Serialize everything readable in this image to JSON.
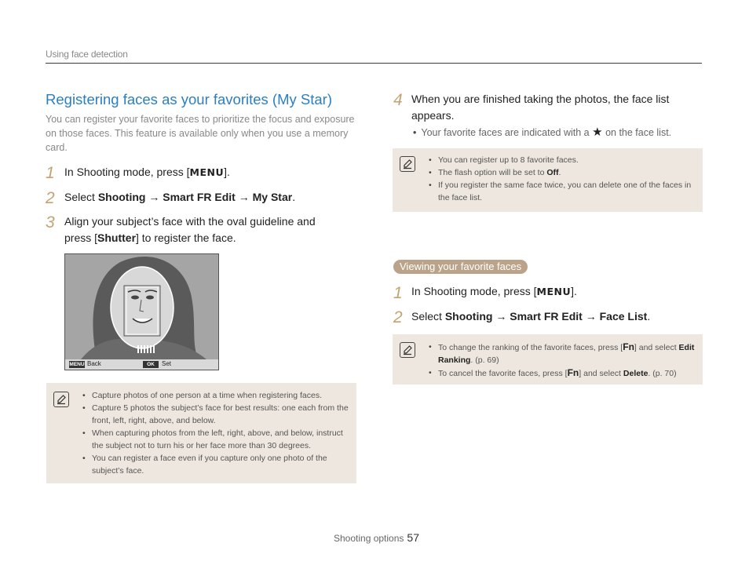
{
  "header": {
    "section": "Using face detection"
  },
  "left": {
    "title": "Registering faces as your favorites (My Star)",
    "intro": "You can register your favorite faces to prioritize the focus and exposure on those faces. This feature is available only when you use a memory card.",
    "step1": {
      "num": "1",
      "before": "In Shooting mode, press [",
      "key": "MENU",
      "after": "]."
    },
    "step2": {
      "num": "2",
      "before": "Select ",
      "b1": "Shooting",
      "arrow1": " → ",
      "b2": "Smart FR Edit",
      "arrow2": " → ",
      "b3": "My Star",
      "after": "."
    },
    "step3": {
      "num": "3",
      "line1": "Align your subject’s face with the oval guideline and",
      "before": "press [",
      "key": "Shutter",
      "after": "] to register the face."
    },
    "photo": {
      "menu_key": "MENU",
      "back": "Back",
      "ok_key": "OK",
      "set": "Set"
    },
    "note": [
      "Capture photos of one person at a time when registering faces.",
      "Capture 5 photos the subject’s face for best results: one each from the front, left, right, above, and below.",
      "When capturing photos from the left, right, above, and below, instruct the subject not to turn his or her face more than 30 degrees.",
      "You can register a face even if you capture only one photo of the subject’s face."
    ]
  },
  "right": {
    "step4": {
      "num": "4",
      "text": "When you are finished taking the photos, the face list appears."
    },
    "step4_bullet": {
      "before": "Your favorite faces are indicated with a",
      "star": "★",
      "after": "on the face list."
    },
    "note1": {
      "item1": "You can register up to 8 favorite faces.",
      "item2_before": "The flash option will be set to ",
      "item2_bold": "Off",
      "item2_after": ".",
      "item3": "If you register the same face twice, you can delete one of the faces in the face list."
    },
    "subheading": "Viewing your favorite faces",
    "step1": {
      "num": "1",
      "before": "In Shooting mode, press [",
      "key": "MENU",
      "after": "]."
    },
    "step2": {
      "num": "2",
      "before": "Select ",
      "b1": "Shooting",
      "arrow1": " → ",
      "b2": "Smart FR Edit",
      "arrow2": " → ",
      "b3": "Face List",
      "after": "."
    },
    "note2": {
      "item1_before": "To change the ranking of the favorite faces, press [",
      "item1_key": "Fn",
      "item1_mid": "] and select ",
      "item1_bold": "Edit Ranking",
      "item1_after": ". (p. 69)",
      "item2_before": "To cancel the favorite faces, press [",
      "item2_key": "Fn",
      "item2_mid": "] and select ",
      "item2_bold": "Delete",
      "item2_after": ". (p. 70)"
    }
  },
  "footer": {
    "label": "Shooting options",
    "page": "57"
  },
  "colors": {
    "title": "#2b7fc2",
    "step_number": "#c4a373",
    "note_bg": "#eee7df",
    "pill_bg": "#bba38a"
  }
}
